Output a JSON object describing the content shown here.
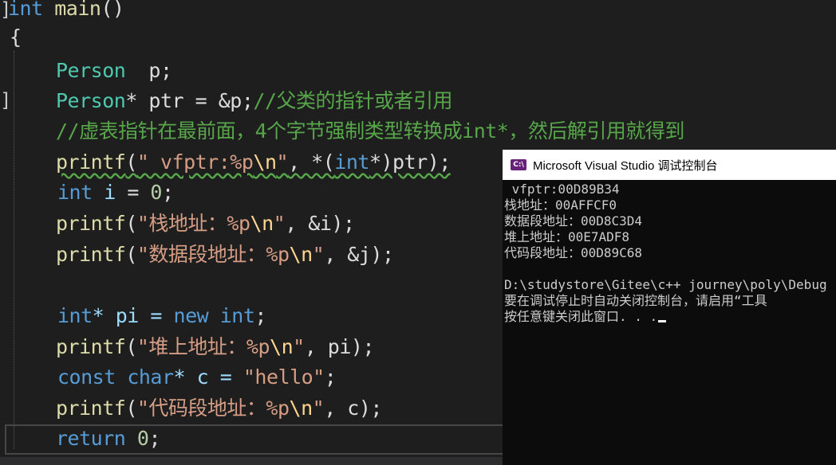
{
  "editor": {
    "fn_sig": {
      "kw_int": "int",
      "name": "main",
      "parens": "()"
    },
    "open_brace": "{",
    "l_person_decl": {
      "type": "Person",
      "rest": "  p;"
    },
    "l_person_ptr": {
      "type": "Person",
      "rest": "* ptr = &p;",
      "comment": "//父类的指针或者引用"
    },
    "l_comment": "//虚表指针在最前面，4个字节强制类型转换成int*，然后解引用就得到",
    "l_printf_vfptr": {
      "fn": "printf",
      "lp": "(",
      "str": "\" vfptr:%p",
      "esc": "\\n",
      "q": "\"",
      "mid": ", *(",
      "kw": "int",
      "tail": "*)ptr);"
    },
    "l_int_i": {
      "kw": "int",
      "var": " i",
      "eq": " = ",
      "num": "0",
      "semi": ";"
    },
    "l_printf_stack": {
      "fn": "printf",
      "lp": "(",
      "str": "\"栈地址：%p",
      "esc": "\\n",
      "q": "\"",
      "tail": ", &i);"
    },
    "l_printf_data": {
      "fn": "printf",
      "lp": "(",
      "str": "\"数据段地址：%p",
      "esc": "\\n",
      "q": "\"",
      "tail": ", &j);"
    },
    "l_new_int": {
      "kw": "int",
      "ptr": "* pi = ",
      "new": "new",
      "sp": " ",
      "kw2": "int",
      "semi": ";"
    },
    "l_printf_heap": {
      "fn": "printf",
      "lp": "(",
      "str": "\"堆上地址：%p",
      "esc": "\\n",
      "q": "\"",
      "tail": ", pi);"
    },
    "l_const_char": {
      "kw": "const",
      "sp": " ",
      "kw2": "char",
      "rest": "* c = ",
      "str": "\"hello\"",
      "semi": ";"
    },
    "l_printf_code": {
      "fn": "printf",
      "lp": "(",
      "str": "\"代码段地址：%p",
      "esc": "\\n",
      "q": "\"",
      "tail": ", c);"
    },
    "l_return": {
      "kw": "return",
      "sp": " ",
      "num": "0",
      "semi": ";"
    }
  },
  "console": {
    "title": "Microsoft Visual Studio 调试控制台",
    "icon": "visual-studio-icon",
    "icon_text": "C:\\",
    "lines": [
      " vfptr:00D89B34",
      "栈地址：00AFFCF0",
      "数据段地址：00D8C3D4",
      "堆上地址：00E7ADF8",
      "代码段地址：00D89C68",
      "",
      "D:\\studystore\\Gitee\\c++ journey\\poly\\Debug",
      "要在调试停止时自动关闭控制台，请启用“工具",
      "按任意键关闭此窗口. . ."
    ]
  }
}
